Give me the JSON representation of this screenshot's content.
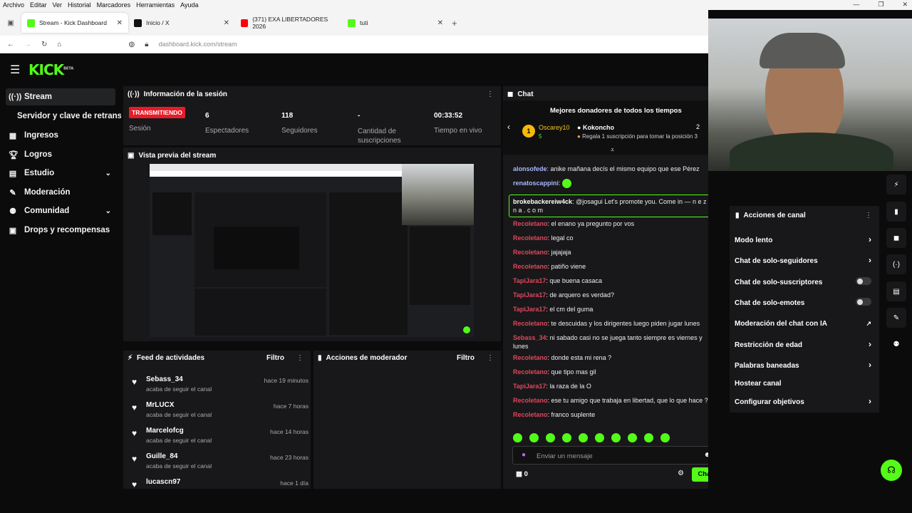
{
  "menubar": {
    "items": [
      "Archivo",
      "Editar",
      "Ver",
      "Historial",
      "Marcadores",
      "Herramientas",
      "Ayuda"
    ]
  },
  "tabs": [
    {
      "label": "Stream - Kick Dashboard",
      "color": "#53fc18"
    },
    {
      "label": "Inicio / X",
      "color": "#111111"
    },
    {
      "label": "(371) EXA LIBERTADORES 2026",
      "color": "#ff0000"
    },
    {
      "label": "tuti",
      "color": "#53fc18"
    }
  ],
  "address": {
    "url": "dashboard.kick.com/stream"
  },
  "brand": {
    "logo": "KICK",
    "beta": "BETA",
    "accent": "#53fc18"
  },
  "nav": [
    {
      "label": "Stream",
      "icon": "broadcast-icon",
      "active": true
    },
    {
      "label": "Servidor y clave de retransmisión",
      "sub": true
    },
    {
      "label": "Ingresos",
      "icon": "revenue-icon"
    },
    {
      "label": "Logros",
      "icon": "trophy-icon"
    },
    {
      "label": "Estudio",
      "icon": "studio-icon",
      "chev": true
    },
    {
      "label": "Moderación",
      "icon": "wrench-icon"
    },
    {
      "label": "Comunidad",
      "icon": "community-icon",
      "chev": true
    },
    {
      "label": "Drops y recompensas",
      "icon": "drops-icon"
    }
  ],
  "session": {
    "title": "Información de la sesión",
    "status": "TRANSMITIENDO",
    "status_label": "Sesión",
    "viewers": "6",
    "viewers_label": "Espectadores",
    "followers": "118",
    "followers_label": "Seguidores",
    "subs": "-",
    "subs_label": "Cantidad de suscripciones",
    "time": "00:33:52",
    "time_label": "Tiempo en vivo"
  },
  "preview": {
    "title": "Vista previa del stream"
  },
  "feed": {
    "title": "Feed de actividades",
    "filter": "Filtro",
    "items": [
      {
        "name": "Sebass_34",
        "sub": "acaba de seguir el canal",
        "time": "hace 19 minutos"
      },
      {
        "name": "MrLUCX",
        "sub": "acaba de seguir el canal",
        "time": "hace 7 horas"
      },
      {
        "name": "Marcelofcg",
        "sub": "acaba de seguir el canal",
        "time": "hace 14 horas"
      },
      {
        "name": "Guille_84",
        "sub": "acaba de seguir el canal",
        "time": "hace 23 horas"
      },
      {
        "name": "lucascn97",
        "sub": "",
        "time": "hace 1 día"
      }
    ]
  },
  "modactions": {
    "title": "Acciones de moderador",
    "filter": "Filtro"
  },
  "chat": {
    "title": "Chat",
    "donors_title": "Mejores donadores de todos los tiempos",
    "donor1": "Oscarey10",
    "donor1_count": "5",
    "donor2": "Kokoncho",
    "donor2_count": "2",
    "gift_text": "Regala 1 suscripción para tomar la posición 3",
    "messages": [
      {
        "user": "alonsofede",
        "color": "#a8b6ff",
        "text": "anike mañana decís el mismo equipo que ese Pérez"
      },
      {
        "user": "renatoscappini",
        "color": "#a8b6ff",
        "text": ""
      },
      {
        "user": "brokebackereiw4ck",
        "color": "#ffffff",
        "text": "@josagui Let's promote you. Come in — n e z h n a . c o m"
      },
      {
        "user": "Recoletano",
        "color": "#e0475b",
        "text": "el enano ya pregunto por vos"
      },
      {
        "user": "Recoletano",
        "color": "#e0475b",
        "text": "legal co"
      },
      {
        "user": "Recoletano",
        "color": "#e0475b",
        "text": "jajajaja"
      },
      {
        "user": "Recoletano",
        "color": "#e0475b",
        "text": "patiño viene"
      },
      {
        "user": "TapiJara17",
        "color": "#e0475b",
        "text": "que buena casaca"
      },
      {
        "user": "TapiJara17",
        "color": "#e0475b",
        "text": "de arquero es verdad?"
      },
      {
        "user": "TapiJara17",
        "color": "#e0475b",
        "text": "el cm del guma"
      },
      {
        "user": "Recoletano",
        "color": "#e0475b",
        "text": "te descuidas y los dirigentes luego piden jugar lunes"
      },
      {
        "user": "Sebass_34",
        "color": "#e0475b",
        "text": "ni sabado casi no se juega tanto siempre es viernes y lunes"
      },
      {
        "user": "Recoletano",
        "color": "#e0475b",
        "text": "donde esta mi rena ?"
      },
      {
        "user": "Recoletano",
        "color": "#e0475b",
        "text": "que tipo mas gil"
      },
      {
        "user": "TapiJara17",
        "color": "#e0475b",
        "text": "la raza de la O"
      },
      {
        "user": "Recoletano",
        "color": "#e0475b",
        "text": "ese tu amigo que trabaja en libertad, que lo que hace ??"
      },
      {
        "user": "Recoletano",
        "color": "#e0475b",
        "text": "franco suplente"
      }
    ],
    "input_placeholder": "Enviar un mensaje",
    "count": "0",
    "send_label": "Chat"
  },
  "actions": {
    "title": "Acciones de canal",
    "items": [
      {
        "label": "Modo lento",
        "kind": "chevron"
      },
      {
        "label": "Chat de solo-seguidores",
        "kind": "chevron"
      },
      {
        "label": "Chat de solo-suscriptores",
        "kind": "toggle"
      },
      {
        "label": "Chat de solo-emotes",
        "kind": "toggle"
      },
      {
        "label": "Moderación del chat con IA",
        "kind": "external"
      },
      {
        "label": "Restricción de edad",
        "kind": "chevron"
      },
      {
        "label": "Palabras baneadas",
        "kind": "chevron"
      },
      {
        "label": "Hostear canal",
        "kind": "none"
      },
      {
        "label": "Configurar objetivos",
        "kind": "chevron"
      }
    ]
  }
}
